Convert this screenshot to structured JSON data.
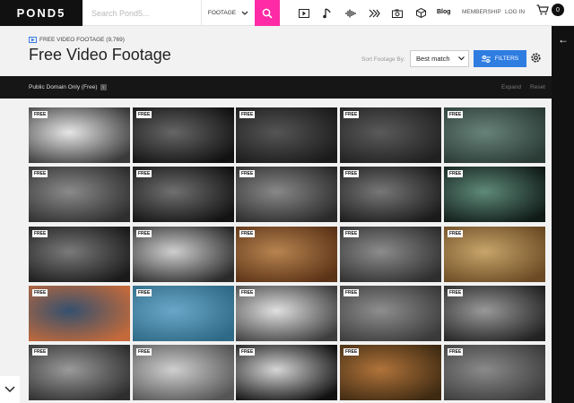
{
  "header": {
    "logo": "POND5",
    "search_placeholder": "Search Pond5...",
    "search_type": "FOOTAGE",
    "media_icons": [
      "footage-icon",
      "music-icon",
      "sound-effects-icon",
      "after-effects-icon",
      "photos-icon",
      "3d-icon"
    ],
    "nav": {
      "blog": "Blog",
      "membership": "MEMBERSHIP",
      "login": "LOG IN"
    },
    "cart_count": "0"
  },
  "page": {
    "subtitle": "FREE VIDEO FOOTAGE (9,769)",
    "title": "Free Video Footage",
    "sort_label": "Sort Footage By:",
    "sort_value": "Best match",
    "filters_label": "FILTERS"
  },
  "filterbar": {
    "public_domain": "Public Domain Only (Free)",
    "expand": "Expand",
    "reset": "Reset"
  },
  "results": {
    "badge": "FREE",
    "thumbnails": [
      {
        "a": "#e6e6e6",
        "b": "#3a3a3a"
      },
      {
        "a": "#666666",
        "b": "#111111"
      },
      {
        "a": "#555555",
        "b": "#1a1a1a"
      },
      {
        "a": "#5a5a5a",
        "b": "#202020"
      },
      {
        "a": "#67837a",
        "b": "#2a3a34"
      },
      {
        "a": "#8a8a8a",
        "b": "#2e2e2e"
      },
      {
        "a": "#707070",
        "b": "#121212"
      },
      {
        "a": "#888888",
        "b": "#2a2a2a"
      },
      {
        "a": "#777777",
        "b": "#1a1a1a"
      },
      {
        "a": "#5f8a7a",
        "b": "#0f1a16"
      },
      {
        "a": "#7a7a7a",
        "b": "#1a1a1a"
      },
      {
        "a": "#cfcfcf",
        "b": "#2a2a2a"
      },
      {
        "a": "#b88450",
        "b": "#5a3216"
      },
      {
        "a": "#8c8c8c",
        "b": "#2e2e2e"
      },
      {
        "a": "#c7a56a",
        "b": "#6b4a24"
      },
      {
        "a": "#34506e",
        "b": "#c46a3a"
      },
      {
        "a": "#6aa6c8",
        "b": "#2e6a86"
      },
      {
        "a": "#e0e0e0",
        "b": "#3e3e3e"
      },
      {
        "a": "#8e8e8e",
        "b": "#3a3a3a"
      },
      {
        "a": "#999999",
        "b": "#222222"
      },
      {
        "a": "#9a9a9a",
        "b": "#2e2e2e"
      },
      {
        "a": "#cfcfcf",
        "b": "#555555"
      },
      {
        "a": "#d6d6d6",
        "b": "#111111"
      },
      {
        "a": "#b0733a",
        "b": "#3e2a12"
      },
      {
        "a": "#8a8a8a",
        "b": "#3c3c3c"
      }
    ]
  }
}
